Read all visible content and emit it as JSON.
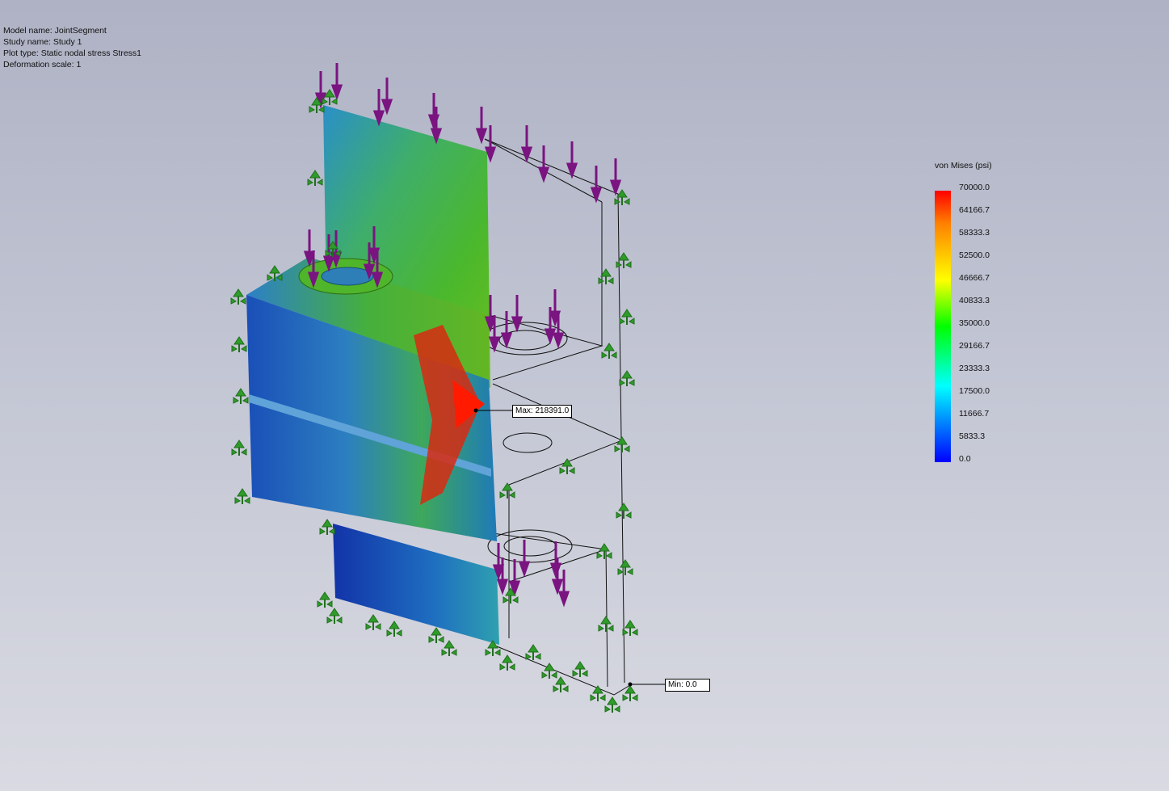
{
  "info": {
    "model_name": "Model name: JointSegment",
    "study_name": "Study name: Study 1",
    "plot_type": "Plot type: Static nodal stress Stress1",
    "deformation_scale": "Deformation scale: 1"
  },
  "legend": {
    "title": "von Mises (psi)",
    "ticks": [
      "70000.0",
      "64166.7",
      "58333.3",
      "52500.0",
      "46666.7",
      "40833.3",
      "35000.0",
      "29166.7",
      "23333.3",
      "17500.0",
      "11666.7",
      "5833.3",
      "0.0"
    ],
    "colors": [
      "#ff0000",
      "#ff8000",
      "#ffff00",
      "#00ff00",
      "#00ffff",
      "#0000ff"
    ]
  },
  "callouts": {
    "max": "Max: 218391.0",
    "min": "Min: 0.0"
  },
  "icons": {
    "load": "load-arrow-icon",
    "fixture": "fixture-arrow-icon"
  }
}
